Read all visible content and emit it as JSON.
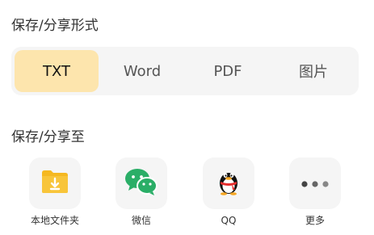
{
  "format_section": {
    "title": "保存/分享形式",
    "options": [
      {
        "label": "TXT",
        "selected": true
      },
      {
        "label": "Word",
        "selected": false
      },
      {
        "label": "PDF",
        "selected": false
      },
      {
        "label": "图片",
        "selected": false
      }
    ]
  },
  "target_section": {
    "title": "保存/分享至",
    "targets": [
      {
        "label": "本地文件夹",
        "icon": "folder-download-icon"
      },
      {
        "label": "微信",
        "icon": "wechat-icon"
      },
      {
        "label": "QQ",
        "icon": "qq-penguin-icon"
      },
      {
        "label": "更多",
        "icon": "more-dots-icon"
      }
    ]
  },
  "colors": {
    "selected_bg": "#fde5ad",
    "panel_bg": "#f5f5f5",
    "folder": "#f5b820",
    "wechat": "#2aae67"
  }
}
